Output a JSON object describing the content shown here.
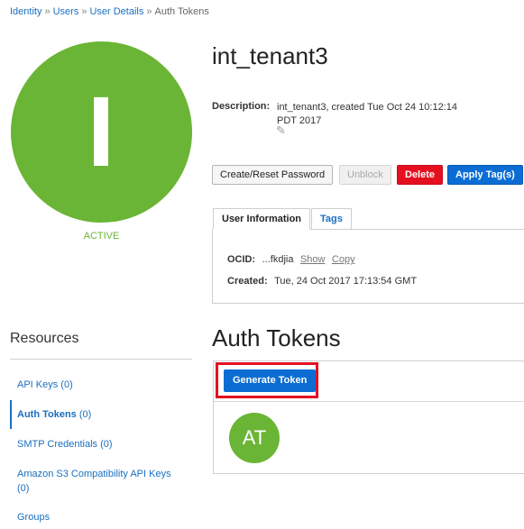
{
  "breadcrumb": {
    "items": [
      "Identity",
      "Users",
      "User Details"
    ],
    "current": "Auth Tokens",
    "separator": "»"
  },
  "user": {
    "avatar_letter": "I",
    "status": "ACTIVE",
    "name": "int_tenant3",
    "description_label": "Description:",
    "description_line1": "int_tenant3, created Tue Oct 24 10:12:14",
    "description_line2": "PDT 2017",
    "edit_icon": "pencil-icon"
  },
  "actions": {
    "create_reset": "Create/Reset Password",
    "unblock": "Unblock",
    "delete": "Delete",
    "apply_tags": "Apply Tag(s)"
  },
  "tabs": {
    "user_info": "User Information",
    "tags": "Tags"
  },
  "info": {
    "ocid_label": "OCID:",
    "ocid_value": "...fkdjia",
    "show": "Show",
    "copy": "Copy",
    "created_label": "Created:",
    "created_value": "Tue, 24 Oct 2017 17:13:54 GMT"
  },
  "resources": {
    "title": "Resources",
    "api_keys": "API Keys (0)",
    "auth_tokens_label": "Auth Tokens",
    "auth_tokens_count": "(0)",
    "smtp": "SMTP Credentials (0)",
    "s3_keys": "Amazon S3 Compatibility API Keys (0)",
    "groups": "Groups"
  },
  "auth_tokens": {
    "title": "Auth Tokens",
    "generate_button": "Generate Token",
    "empty_avatar": "AT"
  },
  "colors": {
    "accent_green": "#6ab535",
    "primary_blue": "#0b6dd3",
    "danger_red": "#e5101f",
    "link_blue": "#1a6fc0"
  }
}
